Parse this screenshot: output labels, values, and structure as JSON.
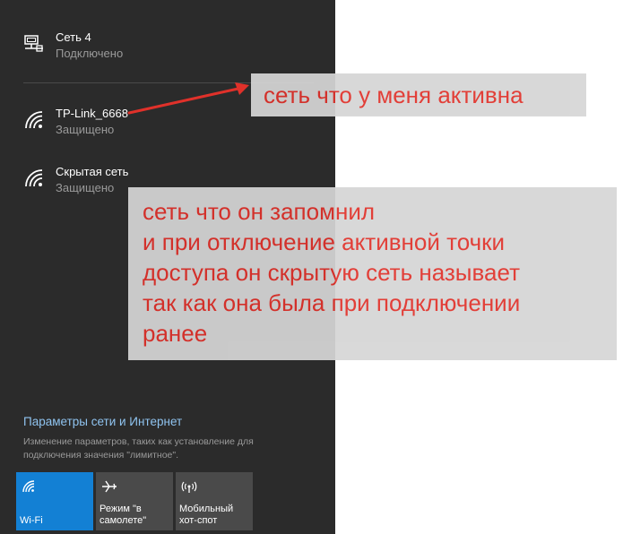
{
  "networks": [
    {
      "name": "Сеть 4",
      "status": "Подключено",
      "icon": "ethernet-icon"
    },
    {
      "name": "TP-Link_6668",
      "status": "Защищено",
      "icon": "wifi-icon"
    },
    {
      "name": "Скрытая сеть",
      "status": "Защищено",
      "icon": "wifi-icon"
    }
  ],
  "settings": {
    "link": "Параметры сети и Интернет",
    "description": "Изменение параметров, таких как установление для подключения значения \"лимитное\"."
  },
  "tiles": [
    {
      "label": "Wi-Fi",
      "icon": "wifi-icon",
      "active": true
    },
    {
      "label": "Режим \"в\nсамолете\"",
      "icon": "airplane-icon",
      "active": false
    },
    {
      "label": "Мобильный\nхот-спот",
      "icon": "hotspot-icon",
      "active": false
    }
  ],
  "annotations": {
    "callout_1": "сеть что у меня активна",
    "callout_2": "сеть что он запомнил\nи при отключение активной точки\nдоступа он скрытую сеть называет\nтак как она была при подключении\nранее"
  },
  "colors": {
    "flyout_bg": "#2b2b2b",
    "accent": "#1380d4",
    "annotation_text": "#e0312a",
    "link": "#8fc3ef"
  }
}
